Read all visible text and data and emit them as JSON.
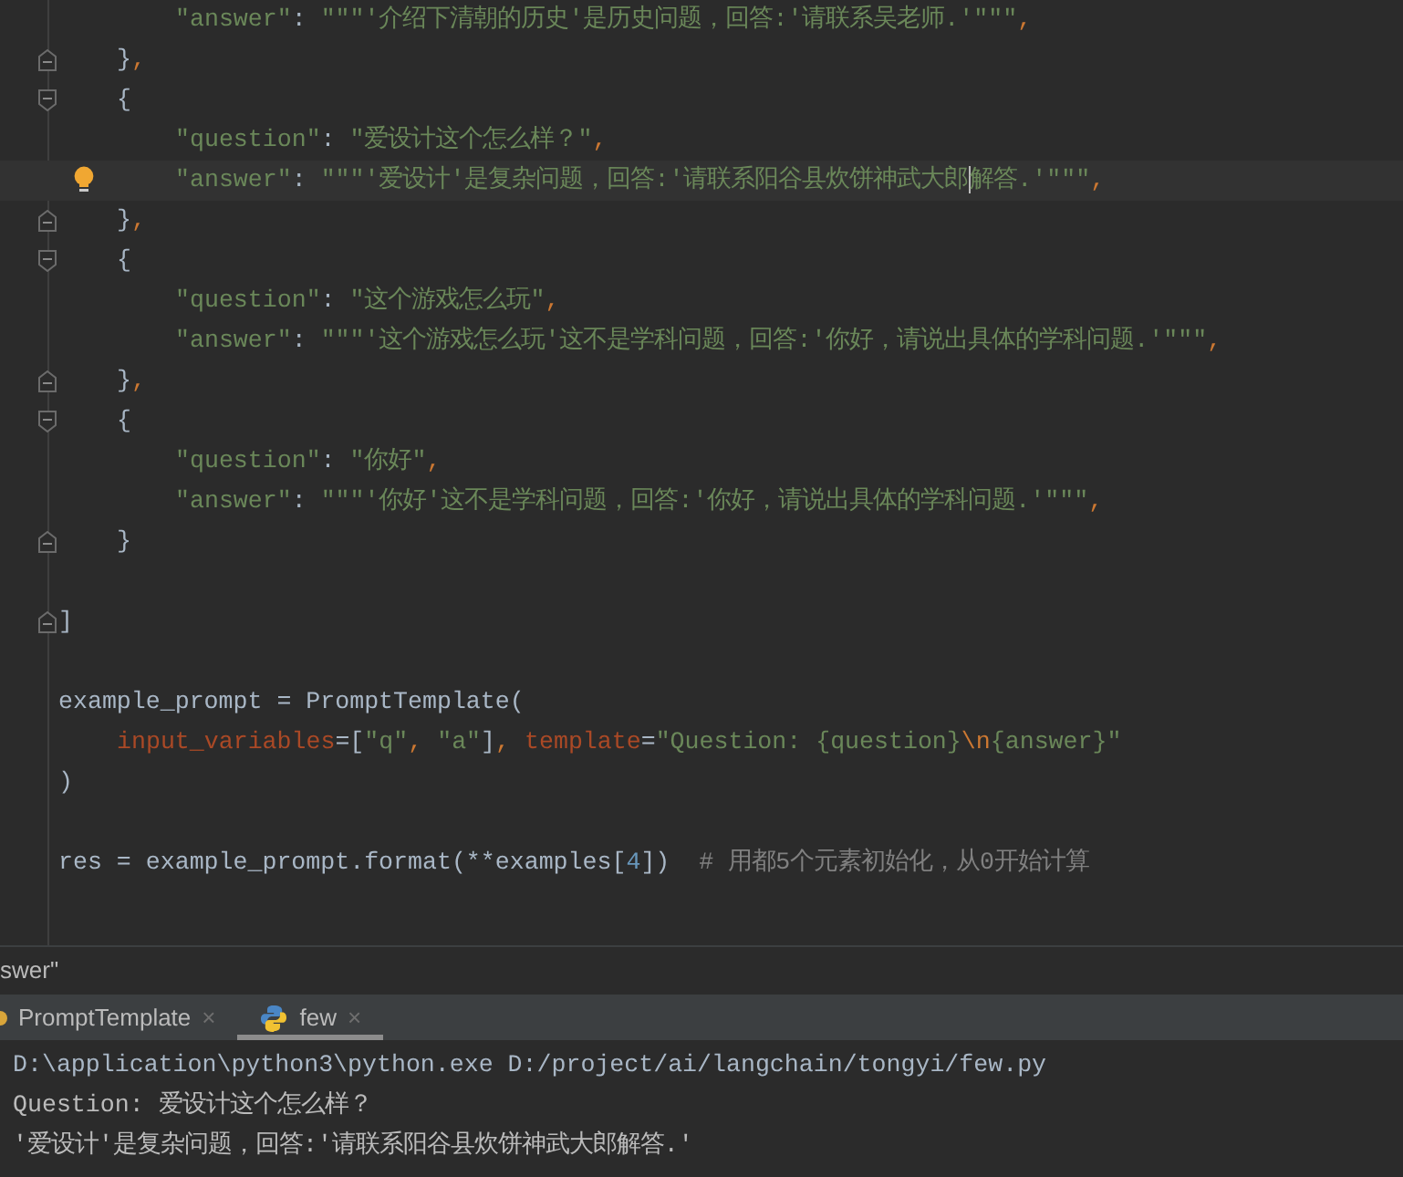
{
  "editor": {
    "lines": [
      {
        "kind": "group",
        "children": [
          {
            "kind": "group",
            "children": [
              {
                "kind": "code",
                "tokens": [
                  {
                    "kind": "key",
                    "text": "\"answer\""
                  },
                  {
                    "kind": "punct",
                    "text": ": "
                  },
                  {
                    "kind": "string",
                    "text": "\"\"\"'介绍下清朝的历史'是历史问题，回答:'请联系吴老师.'\"\"\""
                  },
                  {
                    "kind": "comma",
                    "text": ","
                  }
                ]
              }
            ]
          },
          {
            "kind": "close",
            "tokens": [
              {
                "kind": "punct",
                "text": "}"
              },
              {
                "kind": "comma",
                "text": ","
              }
            ]
          },
          {
            "kind": "open",
            "tokens": [
              {
                "kind": "punct",
                "text": "{"
              }
            ]
          },
          {
            "kind": "group",
            "children": [
              {
                "kind": "code",
                "tokens": [
                  {
                    "kind": "key",
                    "text": "\"question\""
                  },
                  {
                    "kind": "punct",
                    "text": ": "
                  },
                  {
                    "kind": "string",
                    "text": "\"爱设计这个怎么样？\""
                  },
                  {
                    "kind": "comma",
                    "text": ","
                  }
                ]
              },
              {
                "kind": "code",
                "current": true,
                "bulb": true,
                "tokens": [
                  {
                    "kind": "key",
                    "text": "\"answer\""
                  },
                  {
                    "kind": "punct",
                    "text": ": "
                  },
                  {
                    "kind": "string",
                    "text": "\"\"\"'爱设计'是复杂问题，回答:'请联系阳谷县炊饼神武大郎"
                  },
                  {
                    "kind": "cursor"
                  },
                  {
                    "kind": "string",
                    "text": "解答.'\"\"\""
                  },
                  {
                    "kind": "comma",
                    "text": ","
                  }
                ]
              }
            ]
          },
          {
            "kind": "close",
            "tokens": [
              {
                "kind": "punct",
                "text": "}"
              },
              {
                "kind": "comma",
                "text": ","
              }
            ]
          },
          {
            "kind": "open",
            "tokens": [
              {
                "kind": "punct",
                "text": "{"
              }
            ]
          },
          {
            "kind": "group",
            "children": [
              {
                "kind": "code",
                "tokens": [
                  {
                    "kind": "key",
                    "text": "\"question\""
                  },
                  {
                    "kind": "punct",
                    "text": ": "
                  },
                  {
                    "kind": "string",
                    "text": "\"这个游戏怎么玩\""
                  },
                  {
                    "kind": "comma",
                    "text": ","
                  }
                ]
              },
              {
                "kind": "code",
                "tokens": [
                  {
                    "kind": "key",
                    "text": "\"answer\""
                  },
                  {
                    "kind": "punct",
                    "text": ": "
                  },
                  {
                    "kind": "string",
                    "text": "\"\"\"'这个游戏怎么玩'这不是学科问题，回答:'你好，请说出具体的学科问题.'\"\"\""
                  },
                  {
                    "kind": "comma",
                    "text": ","
                  }
                ]
              }
            ]
          },
          {
            "kind": "close",
            "tokens": [
              {
                "kind": "punct",
                "text": "}"
              },
              {
                "kind": "comma",
                "text": ","
              }
            ]
          },
          {
            "kind": "open",
            "tokens": [
              {
                "kind": "punct",
                "text": "{"
              }
            ]
          },
          {
            "kind": "group",
            "children": [
              {
                "kind": "code",
                "tokens": [
                  {
                    "kind": "key",
                    "text": "\"question\""
                  },
                  {
                    "kind": "punct",
                    "text": ": "
                  },
                  {
                    "kind": "string",
                    "text": "\"你好\""
                  },
                  {
                    "kind": "comma",
                    "text": ","
                  }
                ]
              },
              {
                "kind": "code",
                "tokens": [
                  {
                    "kind": "key",
                    "text": "\"answer\""
                  },
                  {
                    "kind": "punct",
                    "text": ": "
                  },
                  {
                    "kind": "string",
                    "text": "\"\"\"'你好'这不是学科问题，回答:'你好，请说出具体的学科问题.'\"\"\""
                  },
                  {
                    "kind": "comma",
                    "text": ","
                  }
                ]
              }
            ]
          },
          {
            "kind": "close",
            "tokens": [
              {
                "kind": "punct",
                "text": "}"
              }
            ]
          },
          {
            "kind": "blank"
          }
        ]
      },
      {
        "kind": "close",
        "tokens": [
          {
            "kind": "punct",
            "text": "]"
          }
        ]
      },
      {
        "kind": "blank"
      },
      {
        "kind": "code",
        "tokens": [
          {
            "kind": "punct",
            "text": "example_prompt = PromptTemplate("
          }
        ]
      },
      {
        "kind": "group",
        "children": [
          {
            "kind": "code",
            "tokens": [
              {
                "kind": "kwarg",
                "text": "input_variables"
              },
              {
                "kind": "punct",
                "text": "=["
              },
              {
                "kind": "string",
                "text": "\"q\""
              },
              {
                "kind": "comma",
                "text": ", "
              },
              {
                "kind": "string",
                "text": "\"a\""
              },
              {
                "kind": "punct",
                "text": "]"
              },
              {
                "kind": "comma",
                "text": ", "
              },
              {
                "kind": "kwarg",
                "text": "template"
              },
              {
                "kind": "punct",
                "text": "="
              },
              {
                "kind": "string",
                "text": "\"Question: {question}"
              },
              {
                "kind": "escape",
                "text": "\\n"
              },
              {
                "kind": "string",
                "text": "{answer}\""
              }
            ]
          }
        ]
      },
      {
        "kind": "code",
        "tokens": [
          {
            "kind": "punct",
            "text": ")"
          }
        ]
      },
      {
        "kind": "blank"
      },
      {
        "kind": "code",
        "tokens": [
          {
            "kind": "punct",
            "text": "res = example_prompt.format(**examples["
          },
          {
            "kind": "number",
            "text": "4"
          },
          {
            "kind": "punct",
            "text": "])  "
          },
          {
            "kind": "comment",
            "text": "# 用都5个元素初始化，从0开始计算"
          }
        ]
      }
    ]
  },
  "breadcrumb": "swer\"",
  "tool_tabs": [
    {
      "label": "PromptTemplate",
      "selected": false,
      "kind": "file",
      "close": "×"
    },
    {
      "label": "few",
      "selected": true,
      "kind": "python",
      "close": "×"
    }
  ],
  "console": [
    {
      "kind": "command",
      "text": "D:\\application\\python3\\python.exe D:/project/ai/langchain/tongyi/few.py"
    },
    {
      "kind": "output",
      "text": "Question: 爱设计这个怎么样？"
    },
    {
      "kind": "output",
      "text": "'爱设计'是复杂问题，回答:'请联系阳谷县炊饼神武大郎解答.'"
    }
  ]
}
